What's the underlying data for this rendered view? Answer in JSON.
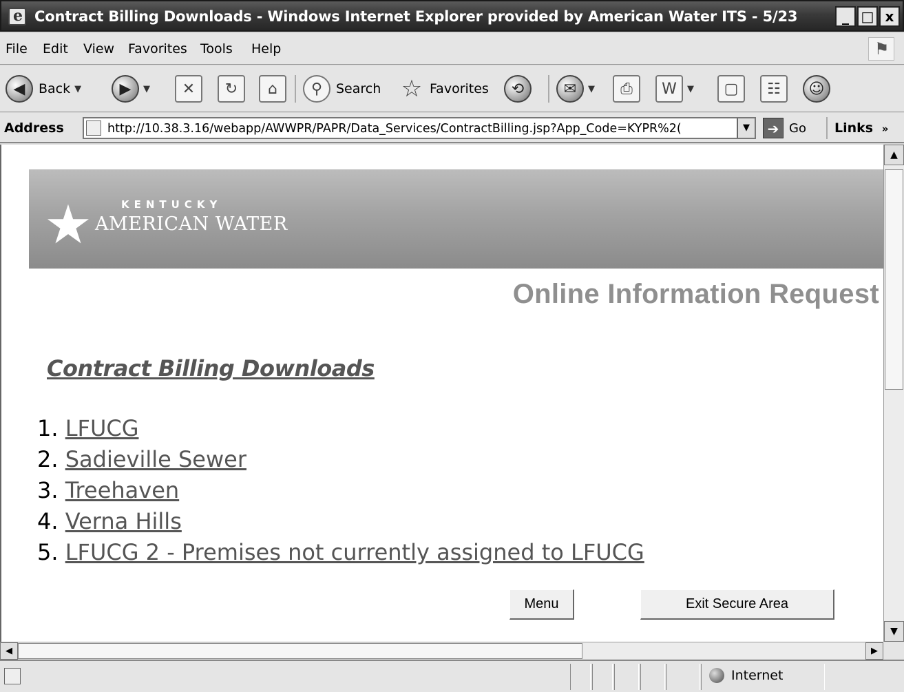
{
  "window": {
    "title": "Contract Billing Downloads - Windows Internet Explorer provided by American Water ITS - 5/23",
    "minimize": "_",
    "maximize": "□",
    "close": "x"
  },
  "menu": [
    "File",
    "Edit",
    "View",
    "Favorites",
    "Tools",
    "Help"
  ],
  "toolbar": {
    "back_label": "Back",
    "search_label": "Search",
    "favorites_label": "Favorites"
  },
  "address": {
    "label": "Address",
    "url": "http://10.38.3.16/webapp/AWWPR/PAPR/Data_Services/ContractBilling.jsp?App_Code=KYPR%2(",
    "go_label": "Go",
    "links_label": "Links"
  },
  "page": {
    "brand_top": "KENTUCKY",
    "brand_name": "AMERICAN WATER",
    "heading": "Online Information Request",
    "section_title": "Contract Billing Downloads",
    "downloads": [
      {
        "num": "1.",
        "label": "LFUCG"
      },
      {
        "num": "2.",
        "label": "Sadieville Sewer"
      },
      {
        "num": "3.",
        "label": "Treehaven"
      },
      {
        "num": "4.",
        "label": "Verna Hills"
      },
      {
        "num": "5.",
        "label": "LFUCG 2 - Premises not currently assigned to LFUCG"
      }
    ],
    "menu_button": "Menu",
    "exit_button": "Exit Secure Area"
  },
  "status": {
    "zone": "Internet"
  },
  "icons": {
    "star": "★",
    "back": "◀",
    "forward": "▶",
    "stop": "✕",
    "refresh": "↻",
    "home": "⌂",
    "search": "⚲",
    "favorites": "☆",
    "history": "⟲",
    "mail": "✉",
    "print": "⎙",
    "edit": "W",
    "discuss": "▢",
    "research": "☷",
    "messenger": "☺",
    "go": "➔",
    "more": "»",
    "dropdown": "▼",
    "scroll_up": "▲",
    "scroll_down": "▼",
    "scroll_left": "◀",
    "scroll_right": "▶"
  }
}
